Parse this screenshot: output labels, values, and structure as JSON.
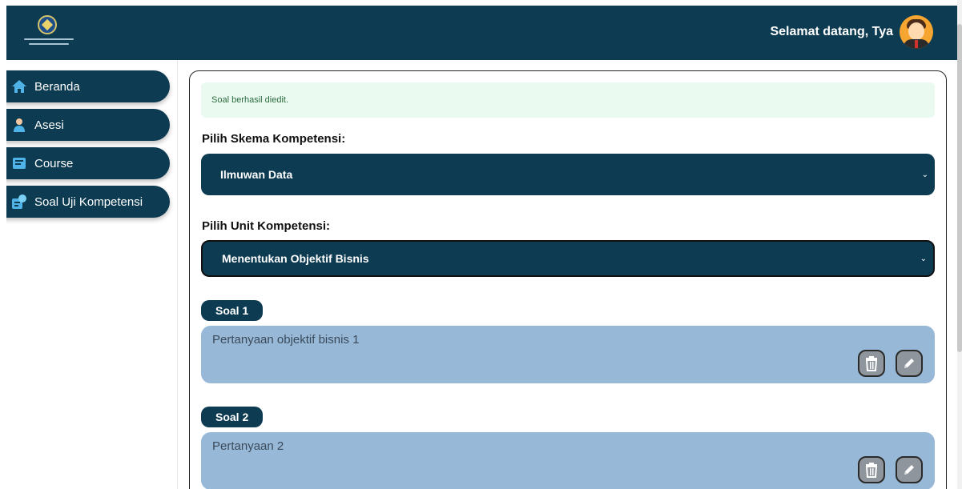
{
  "header": {
    "welcome_text": "Selamat datang, Tya",
    "brand_color": "#0d3b52",
    "logo_icon": "institution-seal-logo",
    "avatar_icon": "user-avatar"
  },
  "sidebar": {
    "items": [
      {
        "label": "Beranda",
        "icon": "home-icon"
      },
      {
        "label": "Asesi",
        "icon": "user-icon"
      },
      {
        "label": "Course",
        "icon": "book-icon"
      },
      {
        "label": "Soal Uji Kompetensi",
        "icon": "quiz-icon"
      }
    ]
  },
  "main": {
    "alert_text": "Soal berhasil diedit.",
    "alert_color": "#eafaf0",
    "skema_label": "Pilih Skema Kompetensi:",
    "skema_value": "Ilmuwan Data",
    "unit_label": "Pilih Unit Kompetensi:",
    "unit_value": "Menentukan Objektif Bisnis",
    "questions": [
      {
        "badge": "Soal 1",
        "text": "Pertanyaan objektif bisnis 1"
      },
      {
        "badge": "Soal 2",
        "text": "Pertanyaan 2"
      }
    ],
    "question_bg_color": "#97b8d7"
  }
}
